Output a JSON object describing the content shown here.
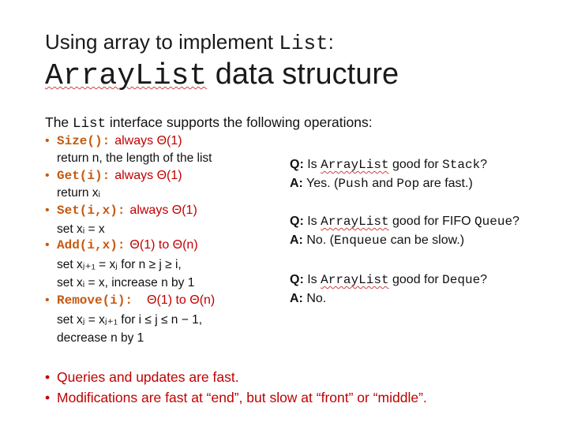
{
  "title": {
    "line1_prefix": "Using array to implement ",
    "line1_code": "List",
    "line1_suffix": ":",
    "line2_code": "ArrayList",
    "line2_suffix": " data structure"
  },
  "intro": {
    "prefix": "The ",
    "code": "List",
    "suffix": " interface supports the following operations:"
  },
  "operations": [
    {
      "name": "Size():",
      "cost": "always Θ(1)",
      "desc": [
        "return n, the length of the list"
      ]
    },
    {
      "name": "Get(i):",
      "cost": "always Θ(1)",
      "desc": [
        "return xᵢ"
      ]
    },
    {
      "name": "Set(i,x):",
      "cost": "always Θ(1)",
      "desc": [
        "set xᵢ = x"
      ]
    },
    {
      "name": "Add(i,x):",
      "cost": "Θ(1) to Θ(n)",
      "desc": [
        "set xⱼ₊₁ = xⱼ for n ≥ j ≥ i,",
        "set xᵢ = x, increase n by 1"
      ]
    },
    {
      "name": "Remove(i):",
      "cost": "Θ(1) to Θ(n)",
      "desc": [
        "set xⱼ = xⱼ₊₁ for i ≤ j ≤ n − 1,",
        "decrease n by 1"
      ]
    }
  ],
  "qa": [
    {
      "q_label": "Q:",
      "q_prefix": " Is ",
      "q_code1": "ArrayList",
      "q_mid": " good for ",
      "q_code2": "Stack",
      "q_end": "?",
      "a_label": "A:",
      "a_prefix": " Yes. (",
      "a_code1": "Push",
      "a_mid": " and ",
      "a_code2": "Pop",
      "a_end": " are fast.)"
    },
    {
      "q_label": "Q:",
      "q_prefix": " Is ",
      "q_code1": "ArrayList",
      "q_mid": " good for FIFO ",
      "q_code2": "Queue",
      "q_end": "?",
      "a_label": "A:",
      "a_prefix": " No. (",
      "a_code1": "Enqueue",
      "a_mid": " can be slow.)",
      "a_code2": "",
      "a_end": ""
    },
    {
      "q_label": "Q:",
      "q_prefix": " Is ",
      "q_code1": "ArrayList",
      "q_mid": " good for ",
      "q_code2": "Deque",
      "q_end": "?",
      "a_label": "A:",
      "a_prefix": " No.",
      "a_code1": "",
      "a_mid": "",
      "a_code2": "",
      "a_end": ""
    }
  ],
  "notes": [
    "Queries and updates are fast.",
    "Modifications are fast at “end”, but slow at “front” or “middle”."
  ],
  "colors": {
    "accent_orange": "#c55a11",
    "accent_red": "#c00000"
  }
}
